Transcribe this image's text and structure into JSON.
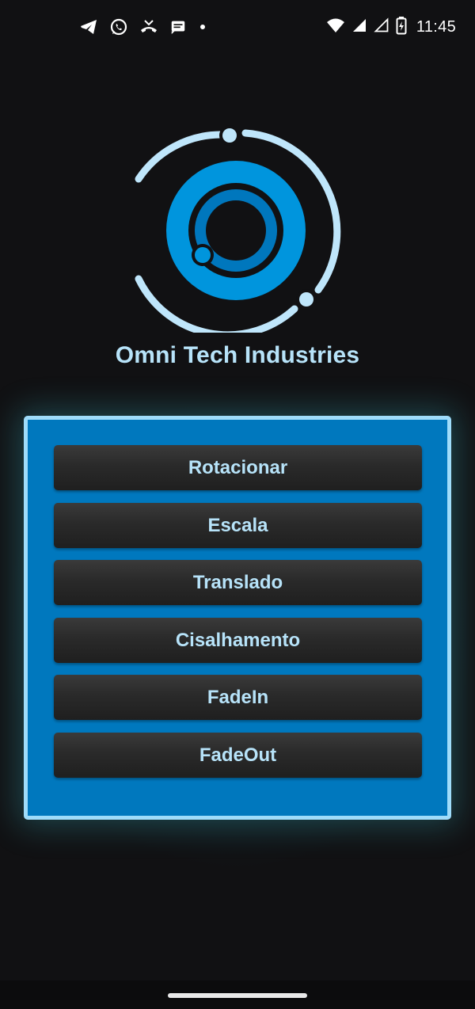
{
  "status_bar": {
    "time": "11:45",
    "left_icons": [
      "telegram-icon",
      "whatsapp-icon",
      "missed-call-icon",
      "message-icon",
      "dot-icon"
    ],
    "right_icons": [
      "wifi-icon",
      "signal-icon",
      "signal-empty-icon",
      "battery-charging-icon"
    ]
  },
  "app": {
    "company_name": "Omni Tech Industries"
  },
  "menu": {
    "buttons": [
      {
        "label": "Rotacionar"
      },
      {
        "label": "Escala"
      },
      {
        "label": "Translado"
      },
      {
        "label": "Cisalhamento"
      },
      {
        "label": "FadeIn"
      },
      {
        "label": "FadeOut"
      }
    ]
  },
  "colors": {
    "background": "#111113",
    "panel": "#0078be",
    "panel_border": "#9fdcfa",
    "button": "#2a2a2a",
    "button_text": "#b7e3f9",
    "logo_outer_ring": "#bfe6fb",
    "logo_main_ring": "#0095dd",
    "logo_inner_ring": "#0077bd"
  }
}
